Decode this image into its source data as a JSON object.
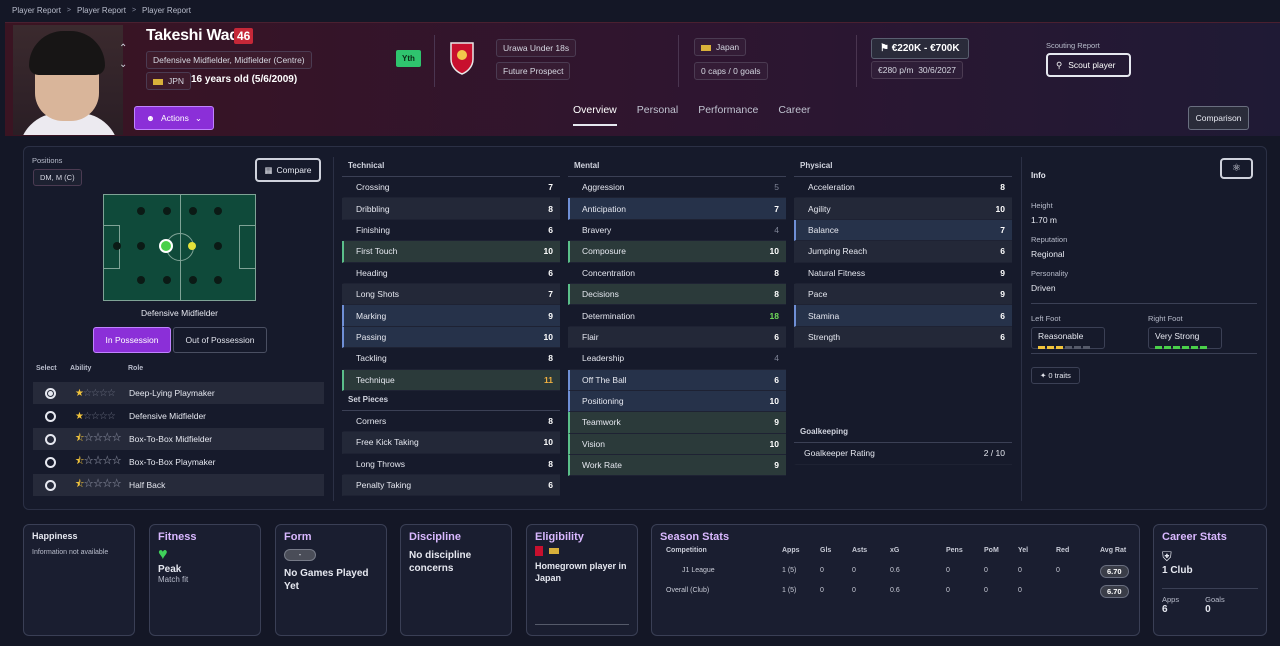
{
  "breadcrumbs": [
    "Player Report",
    "Player Report",
    "Player Report"
  ],
  "player": {
    "name": "Takeshi Wada",
    "ca_badge": "46",
    "positions_text": "Defensive Midfielder, Midfielder (Centre)",
    "nation_code": "JPN",
    "age_text": "16 years old (5/6/2009)",
    "youth_tag": "Yth"
  },
  "club": {
    "team": "Urawa Under 18s",
    "status": "Future Prospect"
  },
  "intl": {
    "nation": "Japan",
    "caps": "0 caps / 0 goals"
  },
  "value": {
    "range": "€220K - €700K",
    "wage": "€280 p/m",
    "expiry": "30/6/2027"
  },
  "scouting": {
    "label": "Scouting Report",
    "button": "Scout player"
  },
  "actions_label": "Actions",
  "tabs": [
    "Overview",
    "Personal",
    "Performance",
    "Career"
  ],
  "comparison_label": "Comparison",
  "positions_panel": {
    "label": "Positions",
    "value": "DM, M (C)",
    "compare": "Compare",
    "pitch_caption": "Defensive Midfielder",
    "in_possession": "In Possession",
    "out_possession": "Out of Possession",
    "hdr_select": "Select",
    "hdr_ability": "Ability",
    "hdr_role": "Role"
  },
  "roles": [
    {
      "name": "Deep-Lying Playmaker",
      "stars": 1
    },
    {
      "name": "Defensive Midfielder",
      "stars": 1
    },
    {
      "name": "Box-To-Box Midfielder",
      "stars": 0.5
    },
    {
      "name": "Box-To-Box Playmaker",
      "stars": 0.5
    },
    {
      "name": "Half Back",
      "stars": 0.5
    }
  ],
  "technical": {
    "title": "Technical",
    "rows": [
      [
        "Crossing",
        "7"
      ],
      [
        "Dribbling",
        "8"
      ],
      [
        "Finishing",
        "6"
      ],
      [
        "First Touch",
        "10"
      ],
      [
        "Heading",
        "6"
      ],
      [
        "Long Shots",
        "7"
      ],
      [
        "Marking",
        "9"
      ],
      [
        "Passing",
        "10"
      ],
      [
        "Tackling",
        "8"
      ],
      [
        "Technique",
        "11"
      ]
    ]
  },
  "set_pieces": {
    "title": "Set Pieces",
    "rows": [
      [
        "Corners",
        "8"
      ],
      [
        "Free Kick Taking",
        "10"
      ],
      [
        "Long Throws",
        "8"
      ],
      [
        "Penalty Taking",
        "6"
      ]
    ]
  },
  "mental": {
    "title": "Mental",
    "rows": [
      [
        "Aggression",
        "5"
      ],
      [
        "Anticipation",
        "7"
      ],
      [
        "Bravery",
        "4"
      ],
      [
        "Composure",
        "10"
      ],
      [
        "Concentration",
        "8"
      ],
      [
        "Decisions",
        "8"
      ],
      [
        "Determination",
        "18"
      ],
      [
        "Flair",
        "6"
      ],
      [
        "Leadership",
        "4"
      ],
      [
        "Off The Ball",
        "6"
      ],
      [
        "Positioning",
        "10"
      ],
      [
        "Teamwork",
        "9"
      ],
      [
        "Vision",
        "10"
      ],
      [
        "Work Rate",
        "9"
      ]
    ]
  },
  "physical": {
    "title": "Physical",
    "rows": [
      [
        "Acceleration",
        "8"
      ],
      [
        "Agility",
        "10"
      ],
      [
        "Balance",
        "7"
      ],
      [
        "Jumping Reach",
        "6"
      ],
      [
        "Natural Fitness",
        "9"
      ],
      [
        "Pace",
        "9"
      ],
      [
        "Stamina",
        "6"
      ],
      [
        "Strength",
        "6"
      ]
    ]
  },
  "goalkeeping": {
    "title": "Goalkeeping",
    "label": "Goalkeeper Rating",
    "value": "2 / 10"
  },
  "info": {
    "title": "Info",
    "height_label": "Height",
    "height": "1.70 m",
    "rep_label": "Reputation",
    "rep": "Regional",
    "pers_label": "Personality",
    "pers": "Driven",
    "lf_label": "Left Foot",
    "lf": "Reasonable",
    "lf_level": 3,
    "rf_label": "Right Foot",
    "rf": "Very Strong",
    "rf_level": 6,
    "traits": "0 traits"
  },
  "happiness": {
    "title": "Happiness",
    "text": "Information not available"
  },
  "fitness": {
    "title": "Fitness",
    "status": "Peak",
    "sub": "Match fit"
  },
  "form": {
    "title": "Form",
    "pill": "-",
    "text": "No Games Played Yet"
  },
  "discipline": {
    "title": "Discipline",
    "text": "No discipline concerns"
  },
  "eligibility": {
    "title": "Eligibility",
    "text": "Homegrown player in Japan"
  },
  "season": {
    "title": "Season Stats",
    "headers": [
      "Competition",
      "Apps",
      "Gls",
      "Asts",
      "xG",
      "Pens",
      "PoM",
      "Yel",
      "Red",
      "Avg Rat"
    ],
    "rows": [
      [
        "J1 League",
        "1 (5)",
        "0",
        "0",
        "0.6",
        "0",
        "0",
        "0",
        "0",
        "6.70"
      ],
      [
        "Overall (Club)",
        "1 (5)",
        "0",
        "0",
        "0.6",
        "0",
        "0",
        "0",
        "",
        "6.70"
      ]
    ]
  },
  "career": {
    "title": "Career Stats",
    "clubs": "1 Club",
    "apps_label": "Apps",
    "apps": "6",
    "goals_label": "Goals",
    "goals": "0"
  },
  "colors": {
    "accent": "#8b2fd8",
    "gold": "#f0c33c",
    "key_green": "#5bbf8a"
  }
}
